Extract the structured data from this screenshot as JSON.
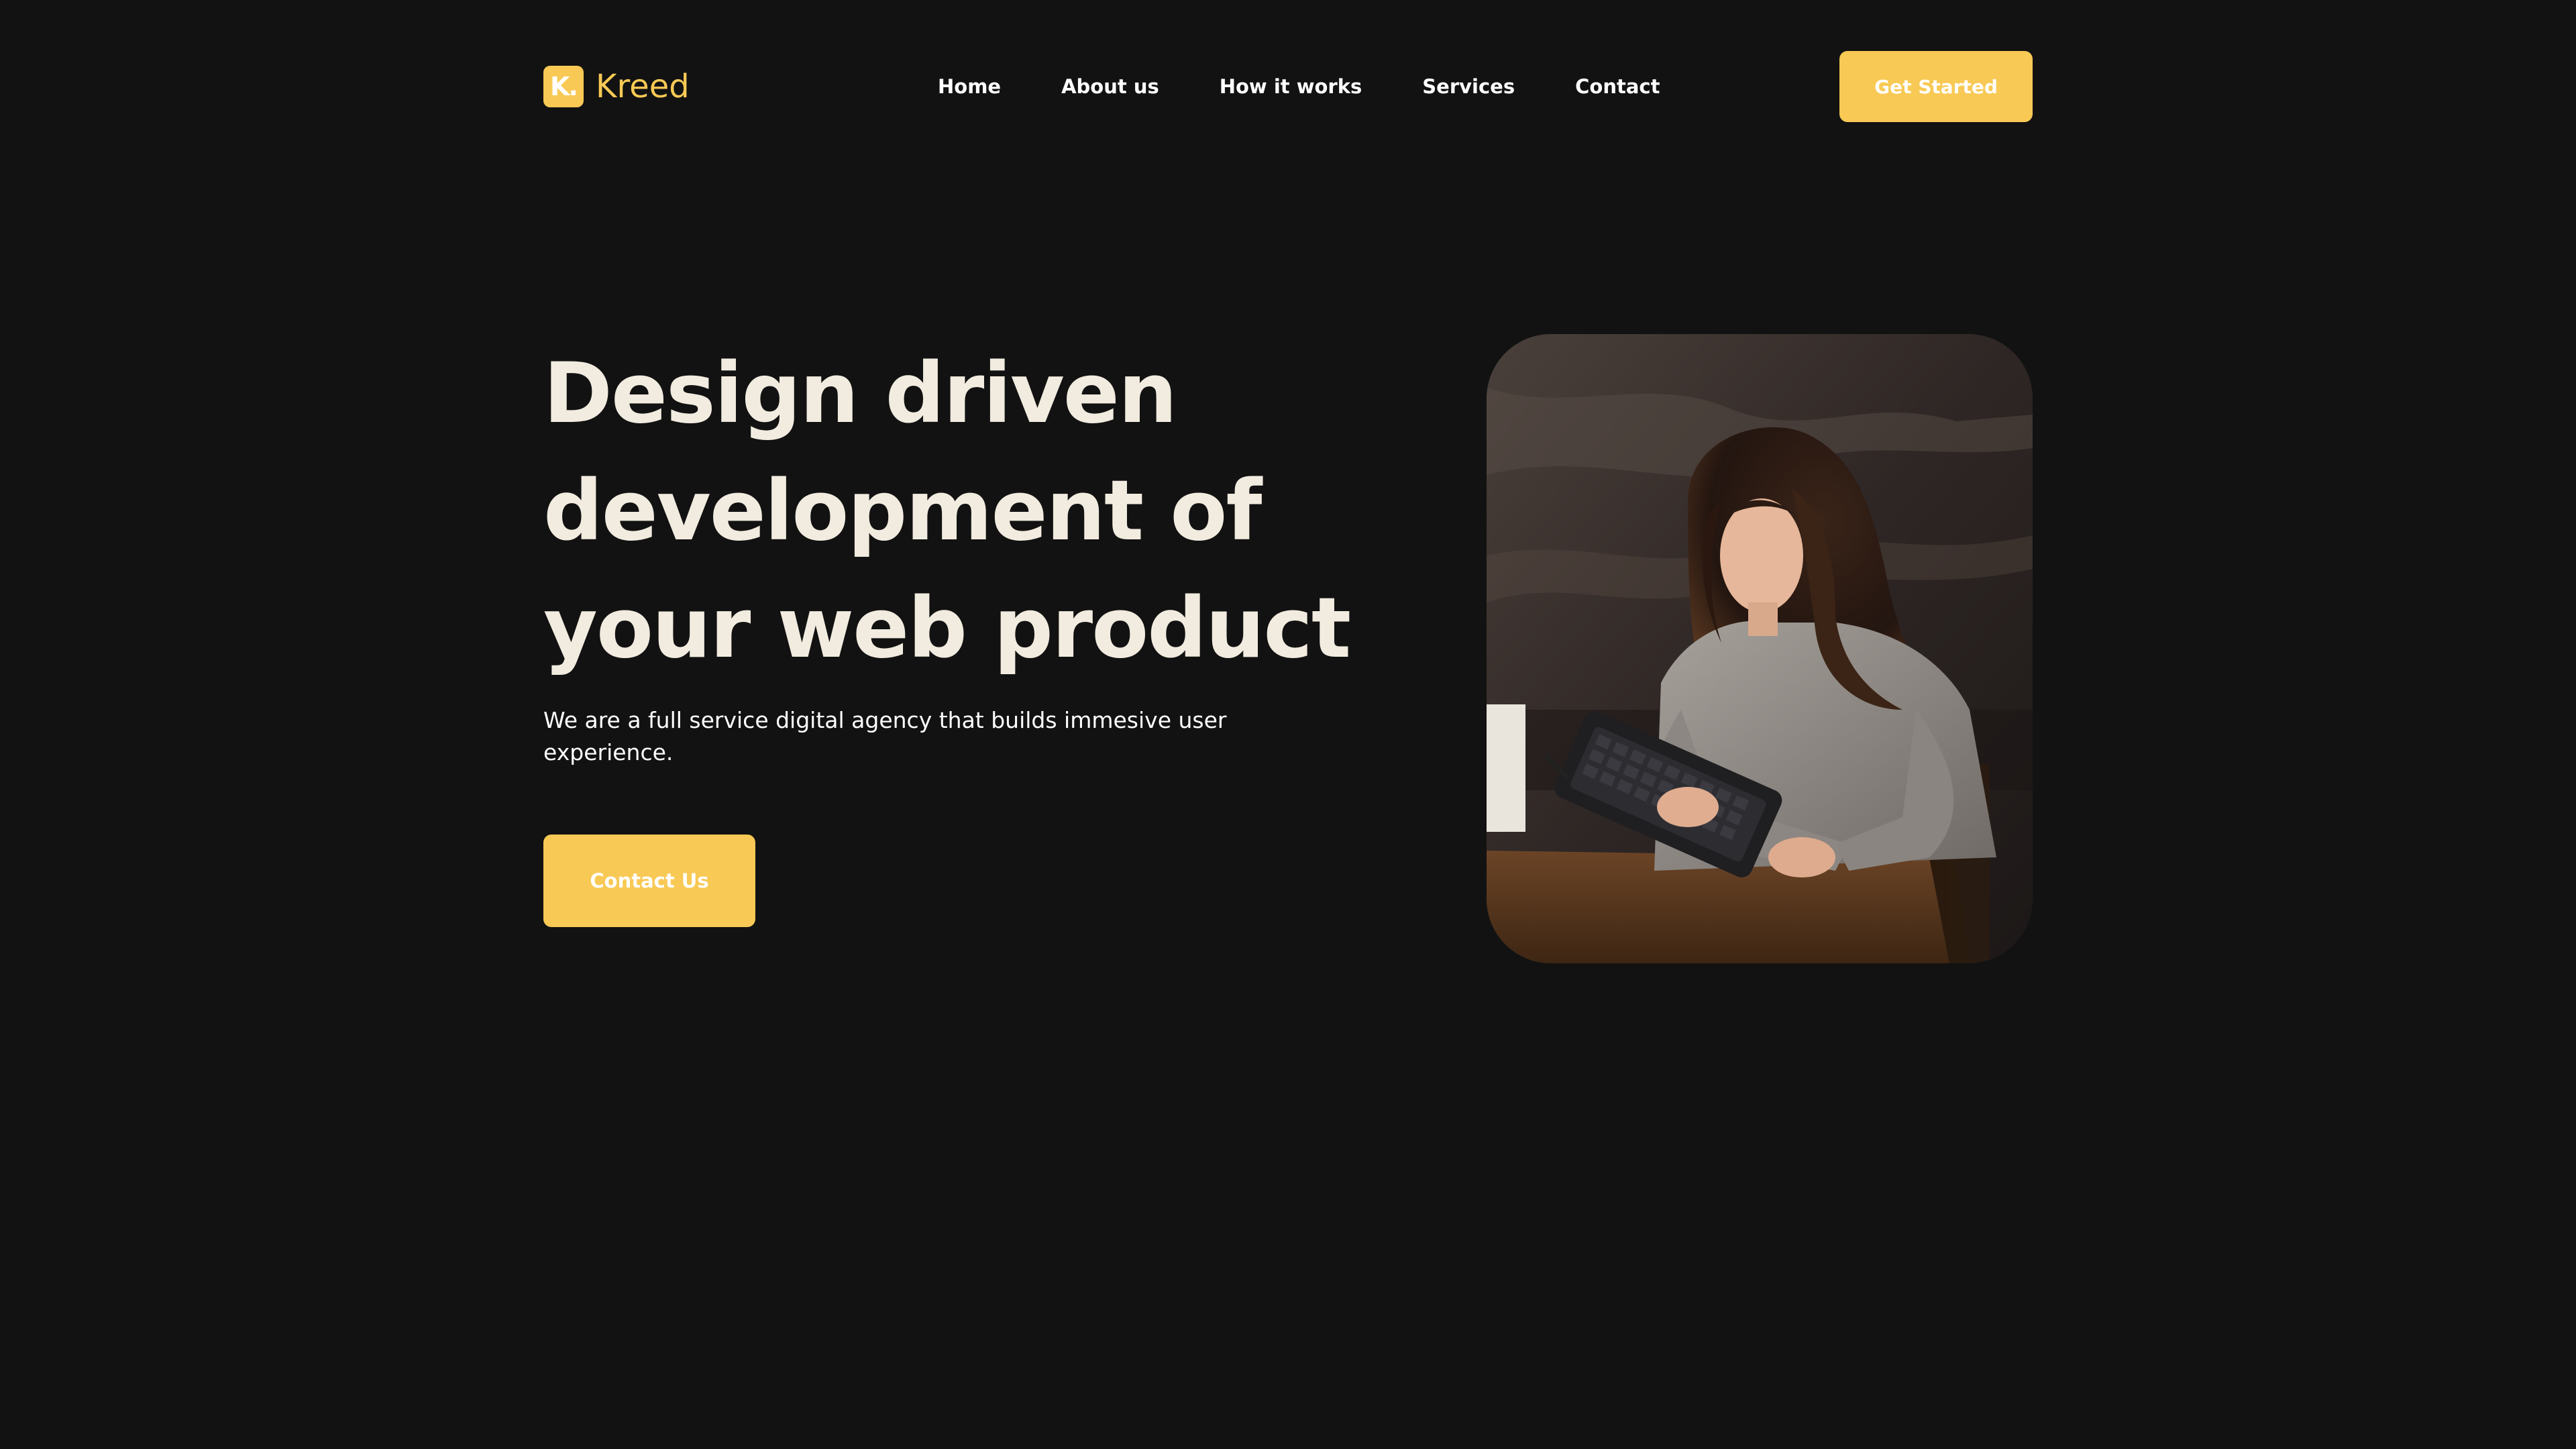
{
  "brand": {
    "name": "Kreed",
    "mark": "K.",
    "accent_color": "#f8c954"
  },
  "nav": {
    "items": [
      {
        "label": "Home"
      },
      {
        "label": "About us"
      },
      {
        "label": "How it works"
      },
      {
        "label": "Services"
      },
      {
        "label": "Contact"
      }
    ]
  },
  "header": {
    "cta_label": "Get Started"
  },
  "hero": {
    "title_lines": [
      "Design driven",
      "development of",
      "your web product"
    ],
    "title_color": "#f2ece0",
    "subtitle": "We are a full service digital agency that builds immesive user experience.",
    "cta_label": "Contact Us",
    "image_icon": "photo-woman-with-tablet"
  },
  "colors": {
    "background": "#121212",
    "text": "#ffffff"
  }
}
